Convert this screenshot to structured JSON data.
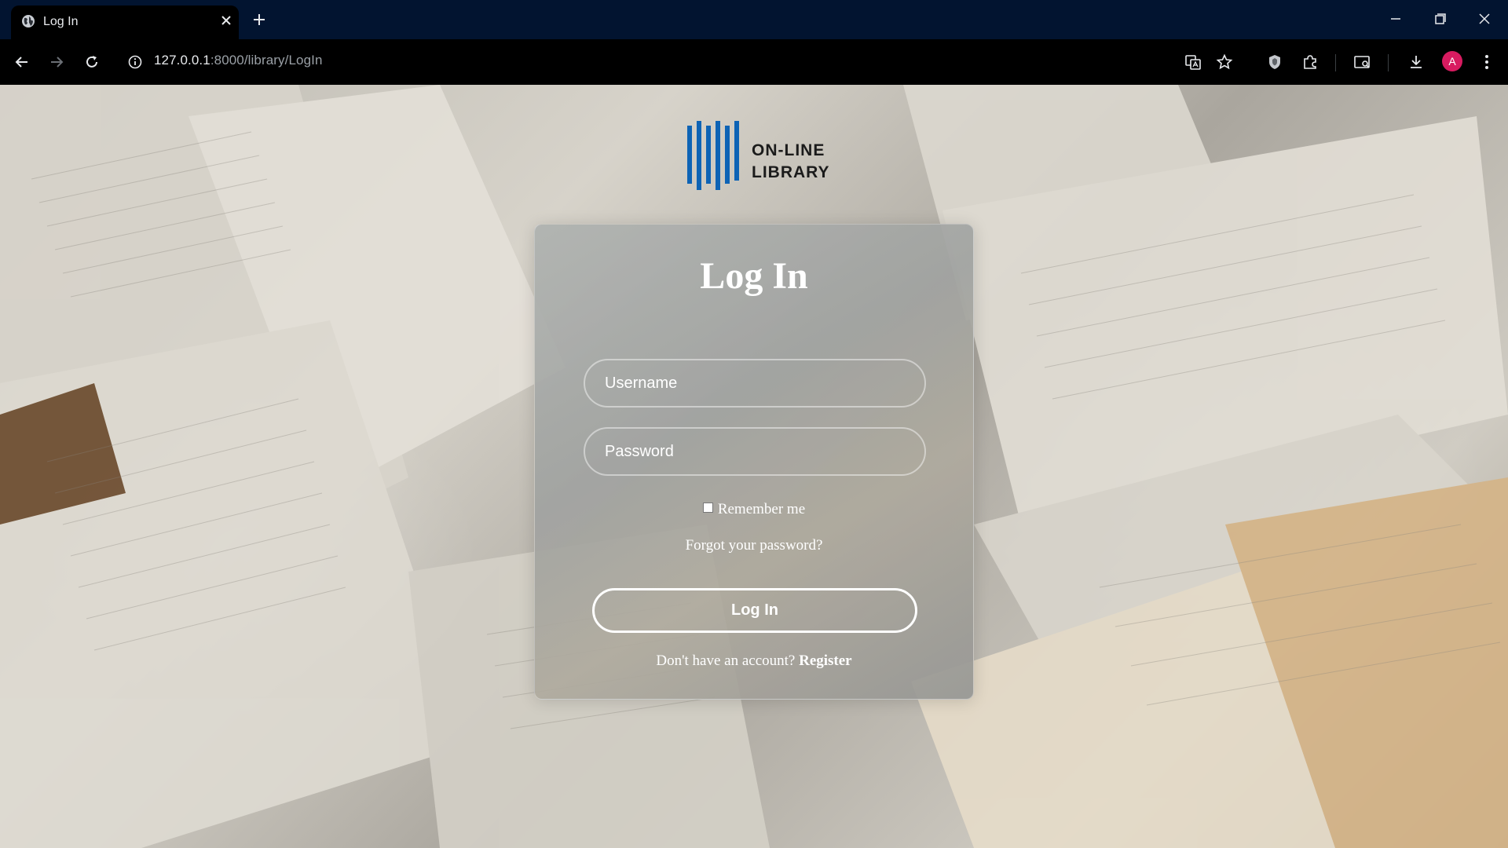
{
  "browser": {
    "tab_title": "Log In",
    "url_host": "127.0.0.1",
    "url_path": ":8000/library/LogIn",
    "avatar_letter": "A",
    "avatar_color": "#d81b60"
  },
  "logo": {
    "line1": "ON-LINE",
    "line2": "LIBRARY",
    "mark_color": "#0d63b5"
  },
  "login": {
    "title": "Log In",
    "username_placeholder": "Username",
    "password_placeholder": "Password",
    "remember_label": "Remember me",
    "forgot_label": "Forgot your password?",
    "submit_label": "Log In",
    "register_prompt": "Don't have an account?",
    "register_link": "Register"
  }
}
